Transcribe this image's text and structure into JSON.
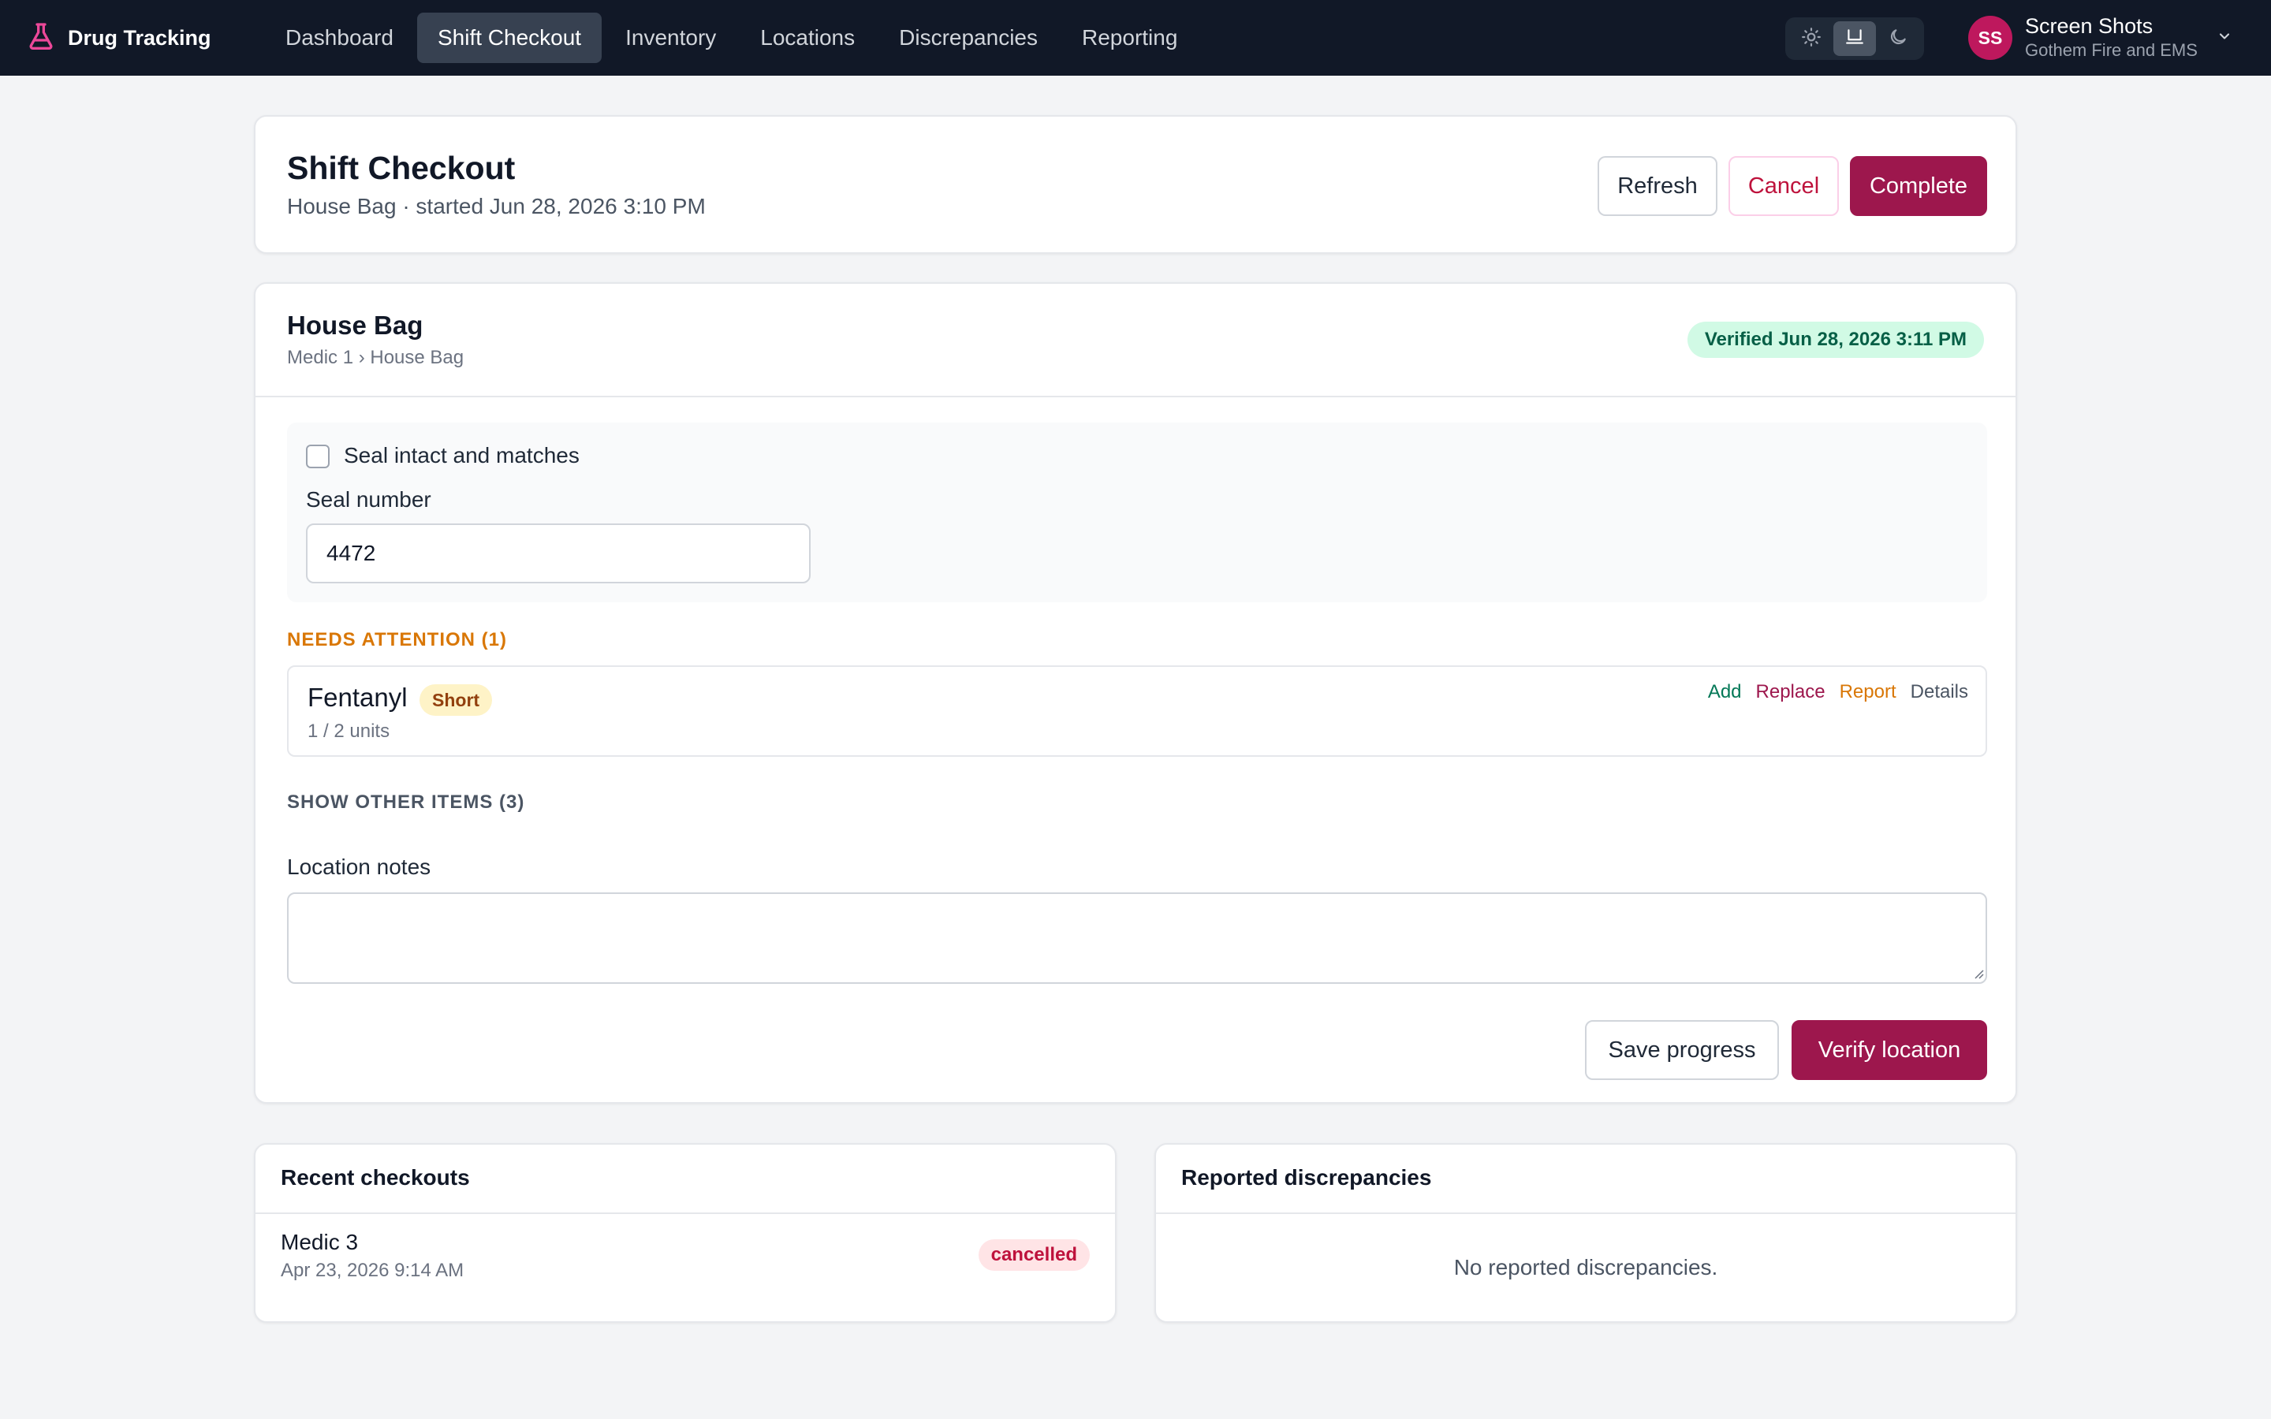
{
  "colors": {
    "nav_bg": "#111827",
    "brand_accent": "#ec4899",
    "primary": "#9d174d",
    "verified_bg": "#d1fae5",
    "warning": "#d97706"
  },
  "nav": {
    "brand": "Drug Tracking",
    "brand_icon": "flask-icon",
    "tabs": [
      {
        "label": "Dashboard"
      },
      {
        "label": "Shift Checkout"
      },
      {
        "label": "Inventory"
      },
      {
        "label": "Locations"
      },
      {
        "label": "Discrepancies"
      },
      {
        "label": "Reporting"
      }
    ],
    "active_tab": "Shift Checkout",
    "theme_options": [
      "light",
      "system",
      "dark"
    ],
    "theme_selected": "system",
    "user": {
      "initials": "SS",
      "name": "Screen Shots",
      "org": "Gothem Fire and EMS"
    }
  },
  "header": {
    "title": "Shift Checkout",
    "subtitle": "House Bag · started Jun 28, 2026 3:10 PM",
    "buttons": {
      "refresh": "Refresh",
      "cancel": "Cancel",
      "complete": "Complete"
    }
  },
  "location": {
    "title": "House Bag",
    "path": "Medic 1 › House Bag",
    "verified_badge": "Verified Jun 28, 2026 3:11 PM",
    "seal": {
      "checkbox_label": "Seal intact and matches",
      "checked": false,
      "number_label": "Seal number",
      "number_value": "4472"
    },
    "needs_attention": {
      "heading": "NEEDS ATTENTION (1)",
      "items": [
        {
          "name": "Fentanyl",
          "status": "Short",
          "units": "1 / 2 units",
          "actions": [
            "Add",
            "Replace",
            "Report",
            "Details"
          ]
        }
      ]
    },
    "show_other": "SHOW OTHER ITEMS (3)",
    "notes": {
      "label": "Location notes",
      "value": ""
    },
    "buttons": {
      "save": "Save progress",
      "verify": "Verify location"
    }
  },
  "recent_checkouts": {
    "title": "Recent checkouts",
    "items": [
      {
        "name": "Medic 3",
        "date": "Apr 23, 2026 9:14 AM",
        "status": "cancelled"
      }
    ]
  },
  "reported_discrepancies": {
    "title": "Reported discrepancies",
    "empty_text": "No reported discrepancies."
  }
}
